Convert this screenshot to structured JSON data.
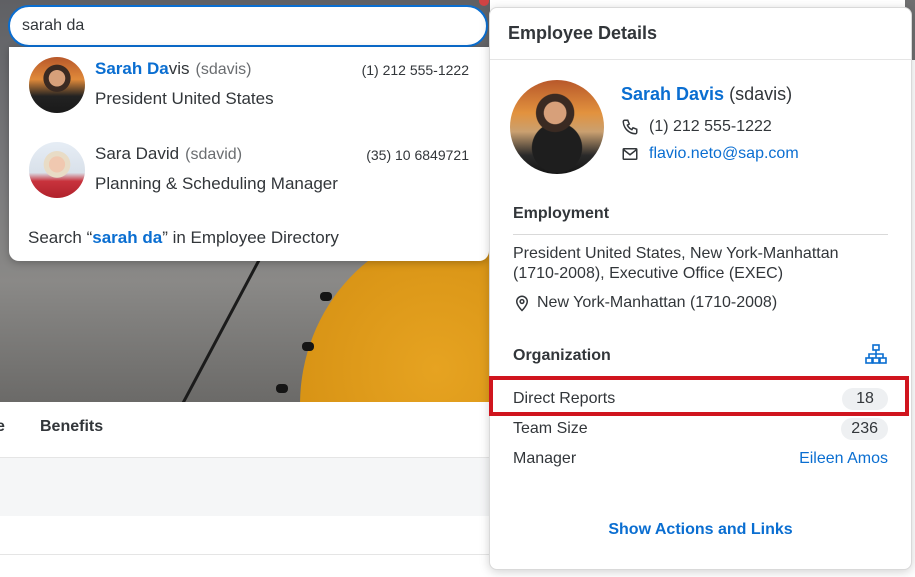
{
  "search": {
    "value": "sarah da"
  },
  "suggestions": [
    {
      "name_highlight": "Sarah Da",
      "name_rest": "vis",
      "username": "(sdavis)",
      "phone": "(1) 212 555-1222",
      "title": "President United States"
    },
    {
      "name_highlight": "",
      "name_rest": "Sara David",
      "username": "(sdavid)",
      "phone": "(35) 10 6849721",
      "title": "Planning & Scheduling Manager"
    }
  ],
  "search_directory": {
    "prefix": "Search “",
    "query": "sarah da",
    "suffix": "” in Employee Directory"
  },
  "tabs": {
    "partial": "e",
    "benefits": "Benefits"
  },
  "panel": {
    "title": "Employee Details",
    "name": "Sarah Davis",
    "username": "(sdavis)",
    "phone": "(1) 212 555-1222",
    "email": "flavio.neto@sap.com",
    "employment": {
      "title": "Employment",
      "description": "President United States, New York-Manhattan (1710-2008), Executive Office (EXEC)",
      "location": "New York-Manhattan (1710-2008)"
    },
    "organization": {
      "title": "Organization",
      "direct_reports_label": "Direct Reports",
      "direct_reports": "18",
      "team_size_label": "Team Size",
      "team_size": "236",
      "manager_label": "Manager",
      "manager": "Eileen Amos"
    },
    "actions_label": "Show Actions and Links"
  },
  "colors": {
    "accent": "#0a6ed1",
    "highlight": "#d0151e"
  }
}
